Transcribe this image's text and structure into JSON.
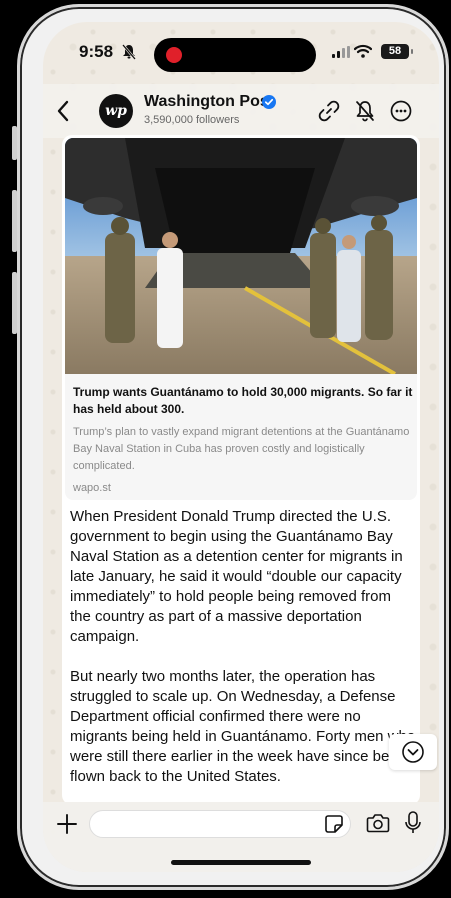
{
  "status_bar": {
    "time": "9:58",
    "battery": "58",
    "icons": [
      "bell-slash-icon",
      "recording-dot-icon",
      "cellular-signal-icon",
      "wifi-icon",
      "battery-icon"
    ]
  },
  "header": {
    "channel_name": "Washington Post",
    "avatar_text": "wp",
    "followers": "3,590,000 followers",
    "icons": [
      "back-chevron-icon",
      "verified-badge-icon",
      "link-icon",
      "bell-off-icon",
      "more-icon"
    ]
  },
  "link_preview": {
    "title": "Trump wants Guantánamo to hold 30,000 migrants. So far it has held about 300.",
    "description": "Trump’s plan to vastly expand migrant detentions at the Guantánamo Bay Naval Station in Cuba has proven costly and logistically complicated.",
    "domain": "wapo.st"
  },
  "message": {
    "paragraphs": [
      "When President Donald Trump directed the U.S. government to begin using the Guantánamo Bay Naval Station as a detention center for migrants in late January, he said it would “double our capacity immediately” to hold people being removed from the country as part of a massive deportation campaign.",
      "But nearly two months later, the operation has struggled to scale up. On Wednesday, a Defense Department official confirmed there were no migrants being held in Guantánamo. Forty men who were still there earlier in the week have since been flown back to the United States."
    ]
  },
  "composer": {
    "placeholder": "",
    "icons": [
      "plus-icon",
      "sticker-icon",
      "camera-icon",
      "microphone-icon"
    ]
  },
  "colors": {
    "chat_bg": "#efeae2",
    "verified": "#1877f2",
    "recording": "#e0202a"
  }
}
